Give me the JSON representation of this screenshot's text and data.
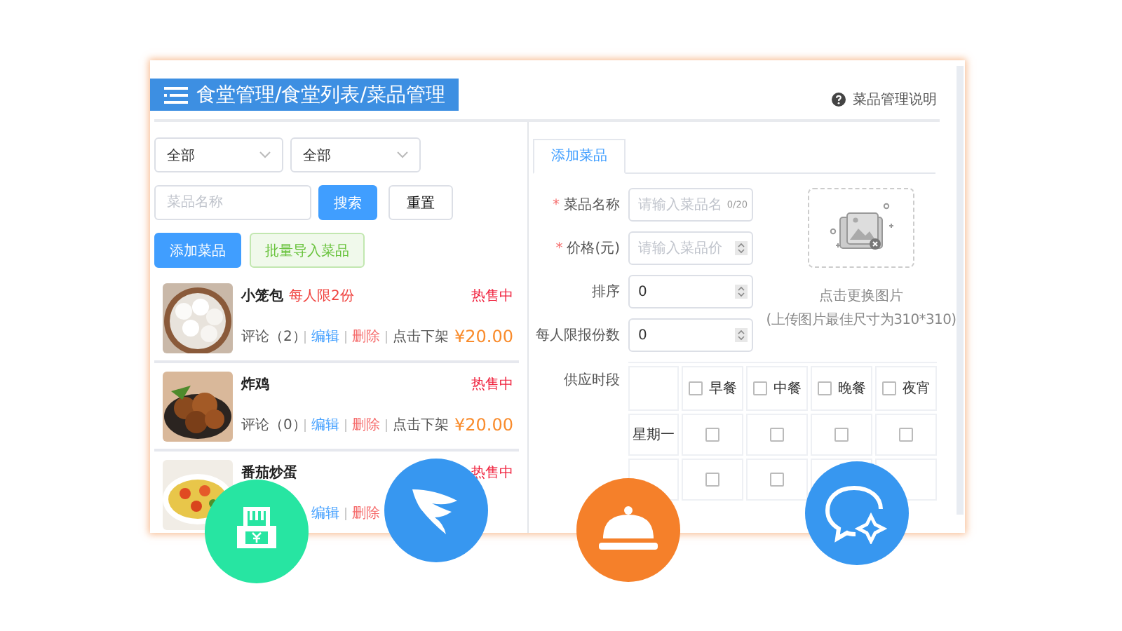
{
  "breadcrumb": {
    "title": "食堂管理/食堂列表/菜品管理"
  },
  "help_link": "菜品管理说明",
  "filters": {
    "selects": [
      "全部",
      "全部"
    ],
    "search": {
      "placeholder": "菜品名称"
    },
    "buttons": [
      "搜索",
      "重置"
    ]
  },
  "actions": [
    "添加菜品",
    "批量导入菜品"
  ],
  "dishes": [
    {
      "name": "小笼包",
      "limit": "每人限2份",
      "status": "热售中",
      "comments": "评论（2）",
      "edit": "编辑",
      "delete": "删除",
      "shelf": "点击下架",
      "price": "¥20.00",
      "kind": "picture"
    },
    {
      "name": "炸鸡",
      "status": "热售中",
      "comments": "评论（0）",
      "edit": "编辑",
      "delete": "删除",
      "shelf": "点击下架",
      "price": "¥20.00",
      "kind": "picture"
    },
    {
      "name": "番茄炒蛋",
      "status": "热售中",
      "edit": "编辑",
      "delete": "删除",
      "kind": "picture"
    }
  ],
  "form": {
    "tabs": [
      {
        "label": "添加菜品",
        "selected": true
      }
    ],
    "fields": [
      {
        "label": "菜品名称",
        "mark": "*",
        "kind": "text",
        "placeholder": "请输入菜品名",
        "counter": "0/20"
      },
      {
        "label": "价格(元)",
        "mark": "*",
        "kind": "number",
        "placeholder": "请输入菜品价"
      },
      {
        "label": "排序",
        "kind": "number",
        "value": "0"
      },
      {
        "label": "每人限报份数",
        "kind": "number",
        "value": "0"
      }
    ],
    "upload": {
      "caption": "点击更换图片",
      "hint": "(上传图片最佳尺寸为310*310)"
    },
    "schedule": {
      "label": "供应时段",
      "meals": [
        {
          "label": "早餐",
          "checked": false
        },
        {
          "label": "中餐",
          "checked": false
        },
        {
          "label": "晚餐",
          "checked": false
        },
        {
          "label": "夜宵",
          "checked": false
        }
      ],
      "days": [
        {
          "day": "星期一",
          "checks": [
            false,
            false,
            false,
            false
          ]
        },
        {
          "checks": [
            false,
            false
          ]
        }
      ]
    }
  },
  "badges": [
    {
      "kind": "cash",
      "color": "#27e5a2"
    },
    {
      "kind": "wing",
      "color": "#3797f0"
    },
    {
      "kind": "cloche",
      "color": "#f5802a"
    },
    {
      "kind": "chat",
      "color": "#3797f0"
    }
  ]
}
